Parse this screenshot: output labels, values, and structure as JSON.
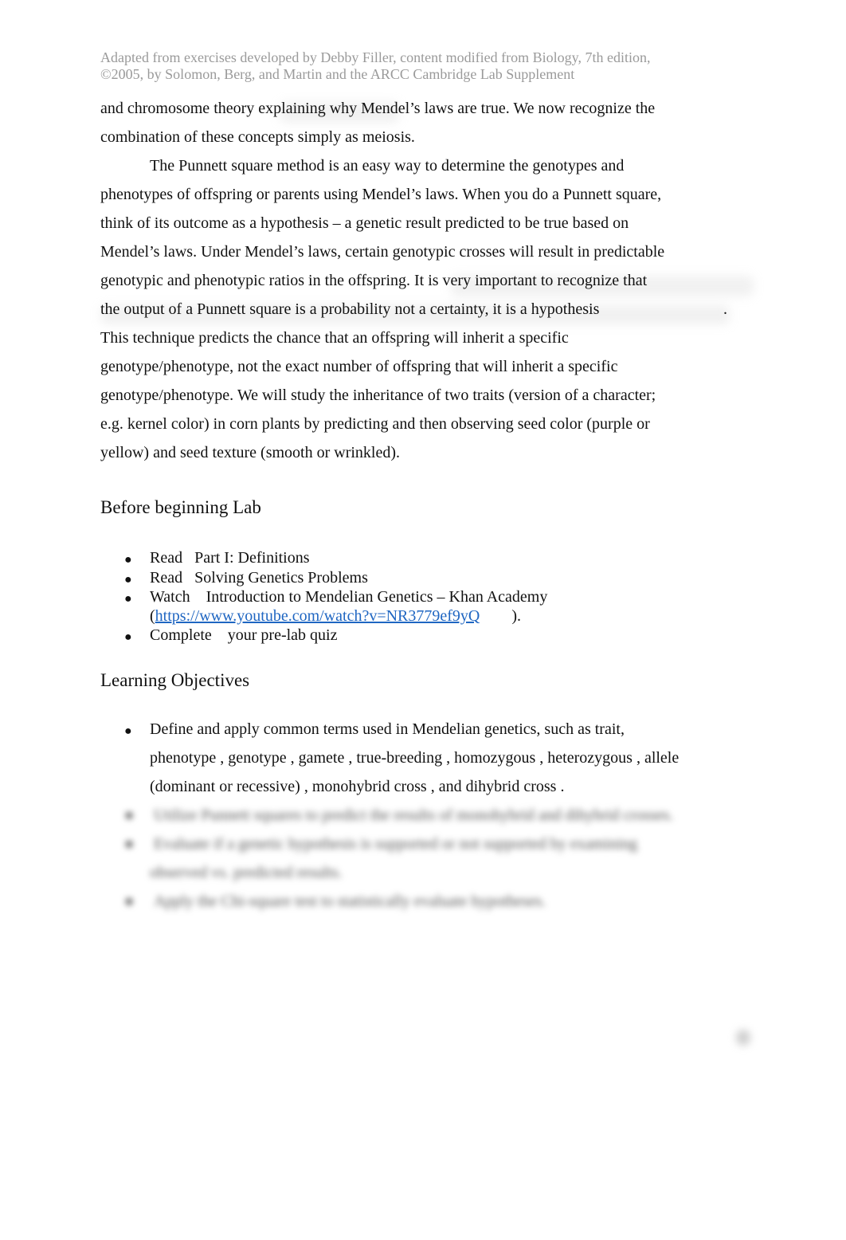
{
  "header": {
    "line1": "Adapted from exercises developed by Debby Filler, content modified from Biology, 7th edition,",
    "line2": "©2005, by Solomon, Berg, and Martin and the ARCC Cambridge Lab Supplement"
  },
  "intro": {
    "lines": [
      "and chromosome theory      explaining why     Mendel’s laws are true. We now recognize the",
      "combination of these concepts simply as meiosis.",
      "The Punnett square method is an easy way to determine the genotypes and",
      "phenotypes of offspring or parents using Mendel’s laws. When you do a Punnett square,",
      "think of its outcome as a hypothesis – a genetic result predicted to be true based on",
      "Mendel’s laws. Under Mendel’s laws, certain genotypic crosses will result in predictable",
      "genotypic and phenotypic ratios in the offspring.        It is very important to recognize that",
      "the output of a Punnett square is a probability not a certainty, it is a hypothesis",
      "This technique predicts the chance that an offspring will inherit a specific",
      "genotype/phenotype,     not   the exact number of offspring that will inherit a specific",
      "genotype/phenotype. We will study the inheritance of two traits (version of a character;",
      "e.g. kernel color) in corn plants by predicting and then observing seed color (purple or",
      "yellow) and seed texture (smooth or wrinkled)."
    ],
    "trailing_period": "."
  },
  "before_lab": {
    "heading": "Before beginning Lab",
    "items": [
      {
        "verb": "Read",
        "text": "Part I: Definitions"
      },
      {
        "verb": "Read",
        "text": "Solving Genetics Problems"
      },
      {
        "verb": "Watch",
        "text": "Introduction to Mendelian Genetics – Khan Academy"
      },
      {
        "verb": "Complete",
        "text": "your pre-lab quiz"
      }
    ],
    "link_open": "(",
    "link": "https://www.youtube.com/watch?v=NR3779ef9yQ",
    "link_close": ")."
  },
  "objectives": {
    "heading": "Learning Objectives",
    "item1": {
      "line1": "Define and apply common terms used in Mendelian genetics, such as            trait,",
      "line2": "phenotype  , genotype  , gamete  , true-breeding  , homozygous  , heterozygous   , allele",
      "line3": "(dominant or recessive)    , monohybrid cross  , and  dihybrid cross  ."
    },
    "blurred_items": [
      "Utilize Punnett squares to predict the results of monohybrid and dihybrid crosses.",
      "Evaluate if a genetic hypothesis is supported or not supported by examining",
      "observed vs. predicted results.",
      "Apply the Chi-square test to statistically evaluate hypotheses."
    ]
  },
  "bullet_glyph": "●"
}
